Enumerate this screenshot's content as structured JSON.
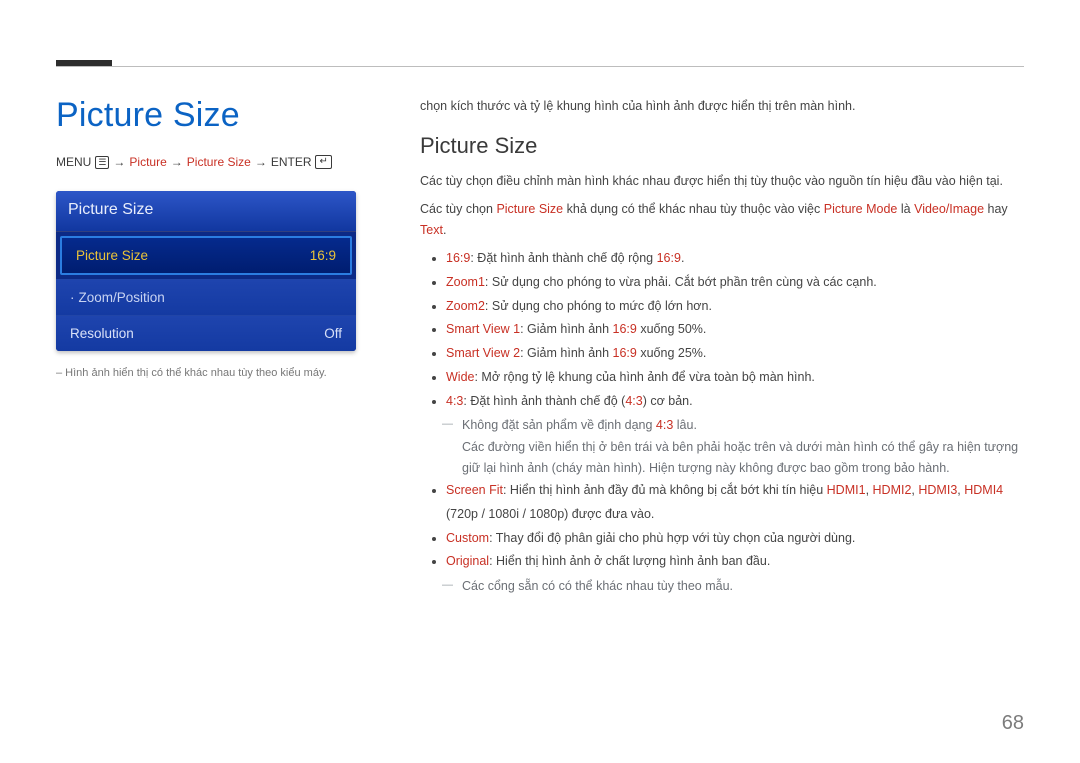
{
  "page_number": "68",
  "left": {
    "heading": "Picture Size",
    "crumb": {
      "menu_label": "MENU",
      "menu_icon": "☰",
      "step1": "Picture",
      "step2": "Picture Size",
      "enter_label": "ENTER",
      "enter_icon": "↵"
    },
    "panel_title": "Picture Size",
    "rows": [
      {
        "label": "Picture Size",
        "value": "16:9",
        "selected": true
      },
      {
        "label": "Zoom/Position",
        "value": "",
        "selected": false,
        "dot": "·"
      },
      {
        "label": "Resolution",
        "value": "Off",
        "selected": false
      }
    ],
    "footnote": "– Hình ảnh hiển thị có thể khác nhau tùy theo kiểu máy."
  },
  "right": {
    "intro": "chọn kích thước và tỷ lệ khung hình của hình ảnh được hiển thị trên màn hình.",
    "heading": "Picture Size",
    "p1": "Các tùy chọn điều chỉnh màn hình khác nhau được hiển thị tùy thuộc vào nguồn tín hiệu đầu vào hiện tại.",
    "p2_parts": {
      "a": "Các tùy chọn ",
      "b": "Picture Size",
      "c": " khả dụng có thể khác nhau tùy thuộc vào việc ",
      "d": "Picture Mode",
      "e": " là ",
      "f": "Video/Image",
      "g": " hay ",
      "h": "Text",
      "i": "."
    },
    "items": [
      {
        "k": "16:9",
        "t": ": Đặt hình ảnh thành chế độ rộng ",
        "ktail": "16:9",
        "post": "."
      },
      {
        "k": "Zoom1",
        "t": ": Sử dụng cho phóng to vừa phải. Cắt bớt phần trên cùng và các cạnh."
      },
      {
        "k": "Zoom2",
        "t": ": Sử dụng cho phóng to mức độ lớn hơn."
      },
      {
        "k": "Smart View 1",
        "t": ": Giảm hình ảnh ",
        "ktail": "16:9",
        "post": " xuống 50%."
      },
      {
        "k": "Smart View 2",
        "t": ": Giảm hình ảnh ",
        "ktail": "16:9",
        "post": " xuống 25%."
      },
      {
        "k": "Wide",
        "t": ": Mở rộng tỷ lệ khung của hình ảnh để vừa toàn bộ màn hình."
      },
      {
        "k": "4:3",
        "t": ": Đặt hình ảnh thành chế độ (",
        "ktail": "4:3",
        "post": ") cơ bản."
      }
    ],
    "sub43": [
      {
        "pre": "Không đặt sản phẩm về định dạng ",
        "hl": "4:3",
        "post": " lâu."
      },
      {
        "text": "Các đường viền hiển thị ở bên trái và bên phải hoặc trên và dưới màn hình có thể gây ra hiện tượng giữ lại hình ảnh (cháy màn hình). Hiện tượng này không được bao gồm trong bảo hành."
      }
    ],
    "screenfit": {
      "k": "Screen Fit",
      "t": ": Hiển thị hình ảnh đầy đủ mà không bị cắt bớt khi tín hiệu ",
      "parts": [
        "HDMI1",
        ", ",
        "HDMI2",
        ", ",
        "HDMI3",
        ", ",
        "HDMI4"
      ],
      "post": " (720p / 1080i / 1080p) được đưa vào."
    },
    "custom": {
      "k": "Custom",
      "t": ": Thay đổi độ phân giải cho phù hợp với tùy chọn của người dùng."
    },
    "original": {
      "k": "Original",
      "t": ": Hiển thị hình ảnh ở chất lượng hình ảnh ban đầu."
    },
    "final_sub": "Các cổng sẵn có có thể khác nhau tùy theo mẫu."
  }
}
